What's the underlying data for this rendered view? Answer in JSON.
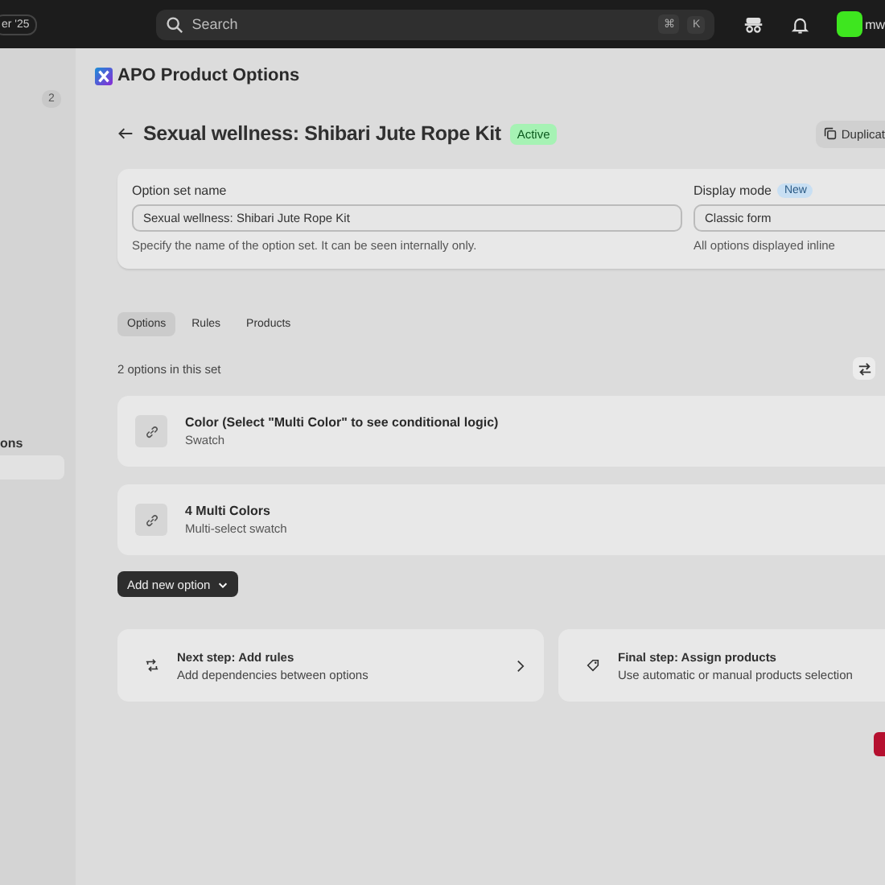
{
  "topbar": {
    "left_badge": "er '25",
    "search": {
      "placeholder": "Search",
      "shortcut_keys": [
        "⌘",
        "K"
      ]
    },
    "avatar_label": "mw"
  },
  "sidebar": {
    "count_badge": "2",
    "section_label": "ons",
    "items": [
      {
        "selected": true
      }
    ]
  },
  "app": {
    "title": "APO Product Options"
  },
  "header": {
    "title": "Sexual wellness: Shibari Jute Rope Kit",
    "status": "Active",
    "duplicate_button": "Duplicat"
  },
  "settings": {
    "name_label": "Option set name",
    "name_value": "Sexual wellness: Shibari Jute Rope Kit",
    "name_help": "Specify the name of the option set. It can be seen internally only.",
    "mode_label": "Display mode",
    "mode_badge": "New",
    "mode_value": "Classic form",
    "mode_help": "All options displayed inline"
  },
  "tabs": [
    {
      "label": "Options",
      "selected": true
    },
    {
      "label": "Rules",
      "selected": false
    },
    {
      "label": "Products",
      "selected": false
    }
  ],
  "options_count": "2 options in this set",
  "options": [
    {
      "title": "Color (Select \"Multi Color\" to see conditional logic)",
      "type": "Swatch"
    },
    {
      "title": "4 Multi Colors",
      "type": "Multi-select swatch"
    }
  ],
  "add_button": "Add new option",
  "steps": [
    {
      "kind": "rules",
      "title": "Next step: Add rules",
      "text": "Add dependencies between options",
      "arrow": true
    },
    {
      "kind": "products",
      "title": "Final step: Assign products",
      "text": "Use automatic or manual products selection",
      "arrow": false
    }
  ]
}
